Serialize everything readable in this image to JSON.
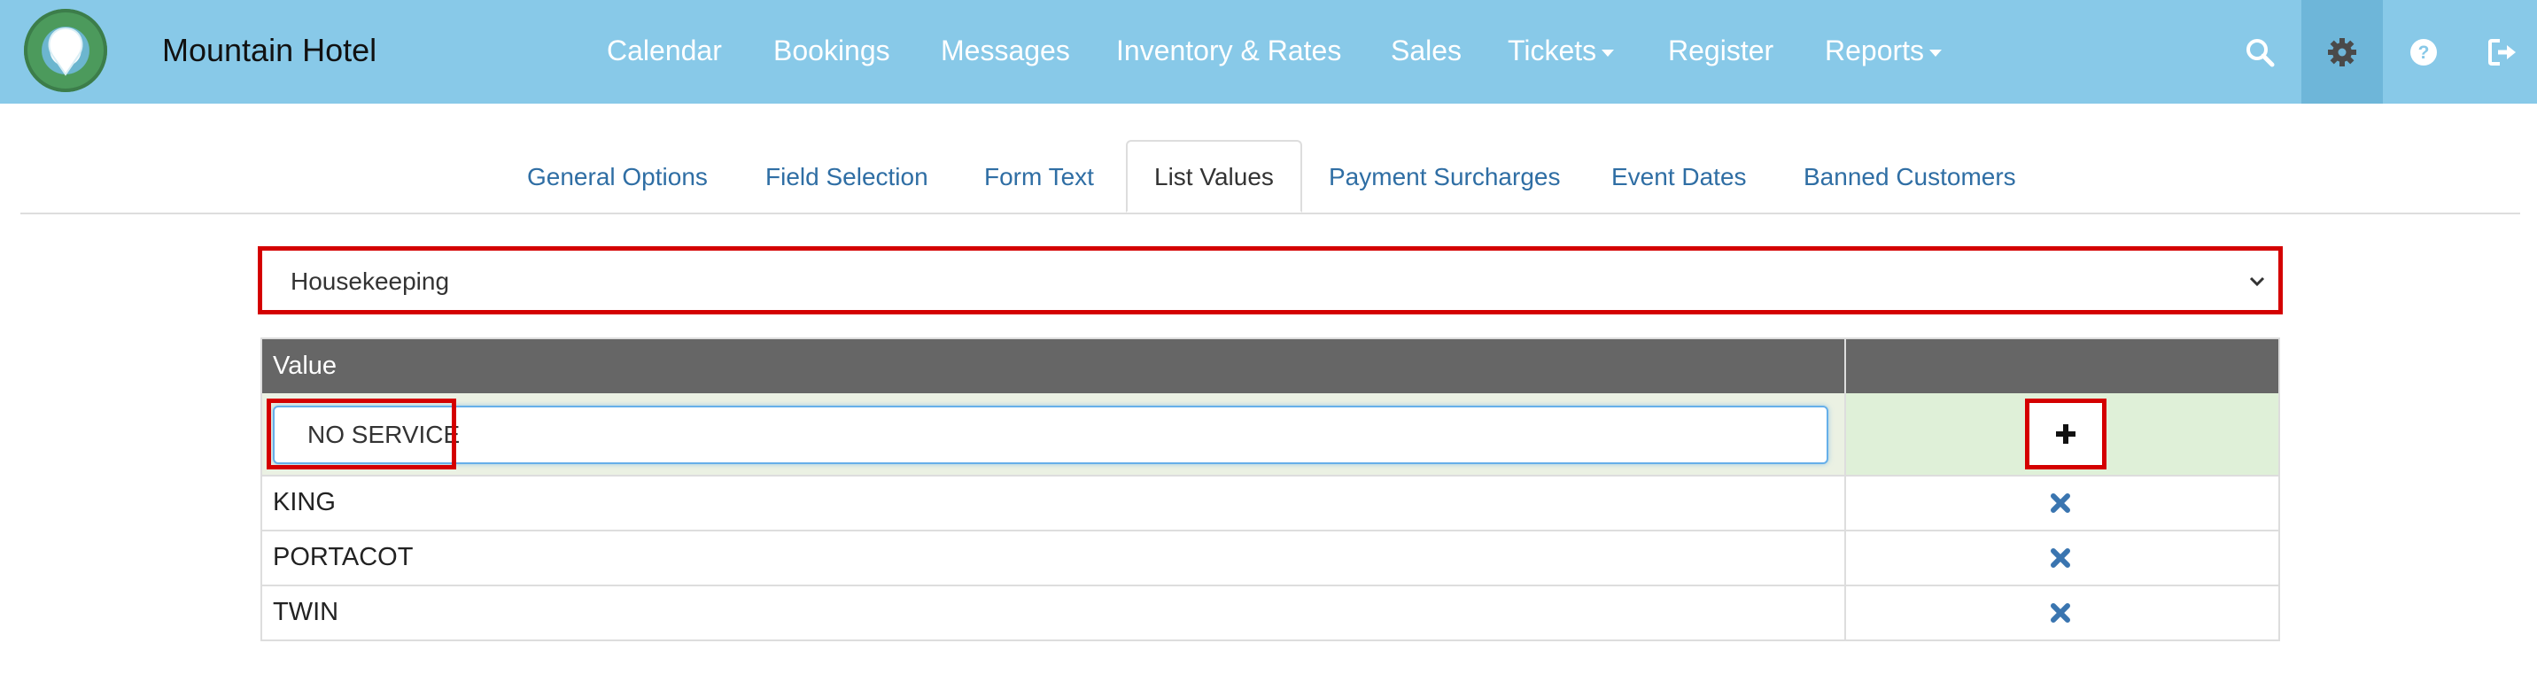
{
  "app": {
    "brand": "Mountain Hotel"
  },
  "nav": {
    "links": [
      {
        "label": "Calendar"
      },
      {
        "label": "Bookings"
      },
      {
        "label": "Messages"
      },
      {
        "label": "Inventory & Rates"
      },
      {
        "label": "Sales"
      },
      {
        "label": "Tickets",
        "has_dropdown": true
      },
      {
        "label": "Register"
      },
      {
        "label": "Reports",
        "has_dropdown": true
      }
    ],
    "icons": [
      "search-icon",
      "gear-icon",
      "help-icon",
      "logout-icon"
    ],
    "active_icon": "gear-icon"
  },
  "tabs": [
    {
      "label": "General Options"
    },
    {
      "label": "Field Selection"
    },
    {
      "label": "Form Text"
    },
    {
      "label": "List Values",
      "active": true
    },
    {
      "label": "Payment Surcharges"
    },
    {
      "label": "Event Dates"
    },
    {
      "label": "Banned Customers"
    }
  ],
  "list_select": {
    "selected": "Housekeeping"
  },
  "table": {
    "header": {
      "value": "Value"
    },
    "new_value": "NO SERVICE",
    "rows": [
      {
        "value": "KING"
      },
      {
        "value": "PORTACOT"
      },
      {
        "value": "TWIN"
      }
    ]
  },
  "colors": {
    "nav_bg": "#88c9e8",
    "link": "#2f6ea4",
    "highlight": "#d40000",
    "table_header": "#666666",
    "delete_icon": "#3a75b0"
  }
}
